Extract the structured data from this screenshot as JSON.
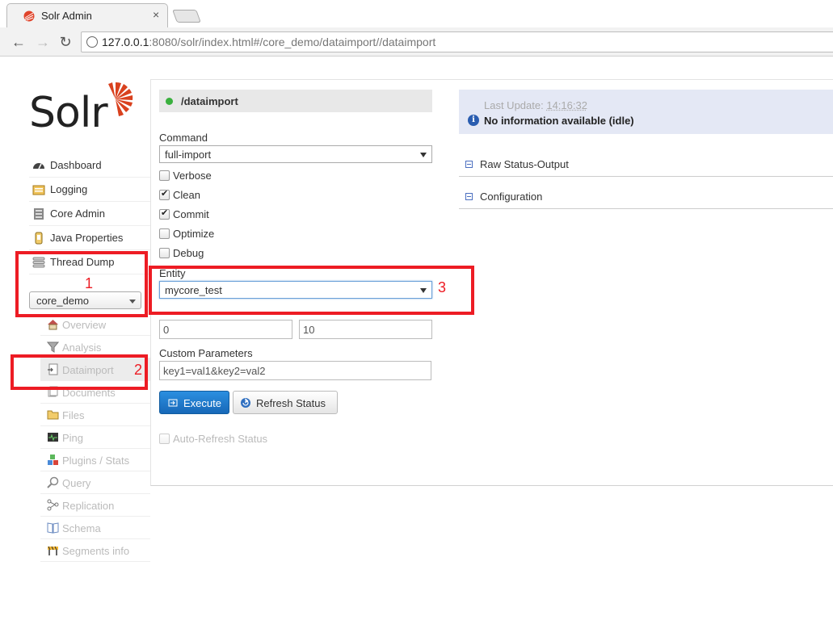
{
  "browser": {
    "tab_title": "Solr Admin",
    "tab_close": "×",
    "url_host": "127.0.0.1",
    "url_rest": ":8080/solr/index.html#/core_demo/dataimport//dataimport",
    "back": "←",
    "forward": "→",
    "reload": "↻"
  },
  "logo": {
    "text": "Solr"
  },
  "nav": [
    {
      "label": "Dashboard",
      "icon": "dashboard-icon"
    },
    {
      "label": "Logging",
      "icon": "logging-icon"
    },
    {
      "label": "Core Admin",
      "icon": "core-admin-icon"
    },
    {
      "label": "Java Properties",
      "icon": "java-properties-icon"
    },
    {
      "label": "Thread Dump",
      "icon": "thread-dump-icon"
    }
  ],
  "core_selector": {
    "value": "core_demo"
  },
  "core_menu": [
    {
      "label": "Overview",
      "icon": "overview-icon"
    },
    {
      "label": "Analysis",
      "icon": "analysis-icon"
    },
    {
      "label": "Dataimport",
      "icon": "dataimport-icon"
    },
    {
      "label": "Documents",
      "icon": "documents-icon"
    },
    {
      "label": "Files",
      "icon": "files-icon"
    },
    {
      "label": "Ping",
      "icon": "ping-icon"
    },
    {
      "label": "Plugins / Stats",
      "icon": "plugins-icon"
    },
    {
      "label": "Query",
      "icon": "query-icon"
    },
    {
      "label": "Replication",
      "icon": "replication-icon"
    },
    {
      "label": "Schema",
      "icon": "schema-icon"
    },
    {
      "label": "Segments info",
      "icon": "segments-icon"
    }
  ],
  "dataimport": {
    "handler": "/dataimport",
    "command_label": "Command",
    "command_value": "full-import",
    "options": [
      {
        "label": "Verbose",
        "checked": false
      },
      {
        "label": "Clean",
        "checked": true
      },
      {
        "label": "Commit",
        "checked": true
      },
      {
        "label": "Optimize",
        "checked": false
      },
      {
        "label": "Debug",
        "checked": false
      }
    ],
    "entity_label": "Entity",
    "entity_value": "mycore_test",
    "start_value": "0",
    "rows_value": "10",
    "custom_params_label": "Custom Parameters",
    "custom_params_value": "key1=val1&key2=val2",
    "execute_label": "Execute",
    "refresh_label": "Refresh Status",
    "auto_refresh_label": "Auto-Refresh Status"
  },
  "status": {
    "last_update_label": "Last Update:",
    "last_update_time": "14:16:32",
    "info_text": "No information available (idle)",
    "sections": [
      "Raw Status-Output",
      "Configuration"
    ]
  },
  "annotations": [
    "1",
    "2",
    "3"
  ],
  "colors": {
    "annotation_red": "#ed1c24",
    "execute_blue": "#1f7bd0",
    "status_green": "#3ab03e",
    "status_panel": "#e4e8f5"
  }
}
